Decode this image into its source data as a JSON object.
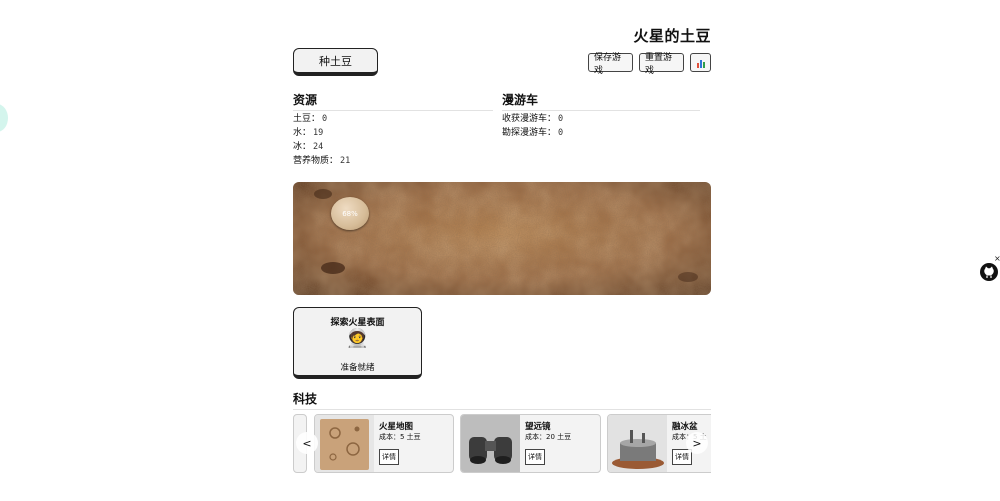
{
  "header": {
    "title": "火星的土豆"
  },
  "actions": {
    "plant_label": "种土豆",
    "save_label": "保存游戏",
    "reset_label": "重置游戏",
    "stats_icon": "bar-chart-icon"
  },
  "resources": {
    "heading": "资源",
    "items": [
      {
        "label": "土豆：",
        "value": "0"
      },
      {
        "label": "水：",
        "value": "19"
      },
      {
        "label": "冰：",
        "value": "24"
      },
      {
        "label": "营养物质：",
        "value": "21"
      }
    ]
  },
  "rovers": {
    "heading": "漫游车",
    "items": [
      {
        "label": "收获漫游车：",
        "value": "0"
      },
      {
        "label": "勘探漫游车：",
        "value": "0"
      }
    ]
  },
  "field": {
    "potato_timer": "68%"
  },
  "explore": {
    "title": "探索火星表面",
    "icon": "astronaut-icon",
    "status": "准备就绪"
  },
  "tech": {
    "heading": "科技",
    "prev_label": "<",
    "next_label": ">",
    "cards": [
      {
        "name": "火星地图",
        "cost": "成本：5 土豆",
        "detail_label": "详情",
        "icon": "mars-map-thumbnail"
      },
      {
        "name": "望远镜",
        "cost": "成本：20 土豆",
        "detail_label": "详情",
        "icon": "binoculars-thumbnail"
      },
      {
        "name": "融冰盆",
        "cost": "成本：5 土",
        "detail_label": "详情",
        "icon": "ice-melter-thumbnail"
      }
    ]
  },
  "widget": {
    "close_label": "×",
    "icon": "github-cat-icon"
  },
  "colors": {
    "mars_soil": "#8a5a33",
    "card_bg": "#f2f2f2",
    "accent_border": "#222222"
  }
}
